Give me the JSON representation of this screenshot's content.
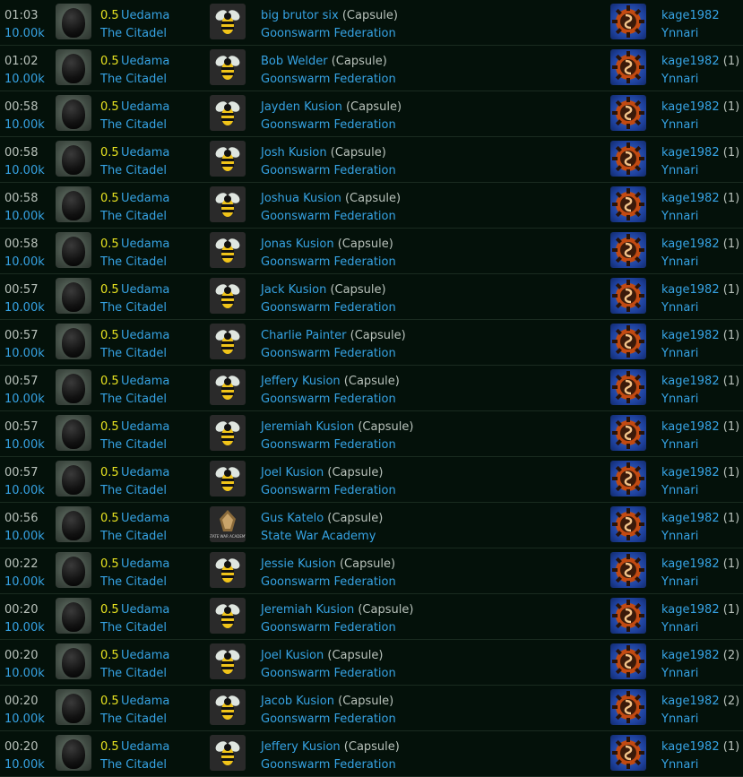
{
  "rows": [
    {
      "time": "01:03",
      "value": "10.00k",
      "sec": "0.5",
      "system": "Uedama",
      "region": "The Citadel",
      "victim": "big brutor six",
      "shiptype": "(Capsule)",
      "corp": "Goonswarm Federation",
      "corp_logo": "bee-icon",
      "attacker": "kage1982",
      "count": "",
      "att_corp": "Ynnari"
    },
    {
      "time": "01:02",
      "value": "10.00k",
      "sec": "0.5",
      "system": "Uedama",
      "region": "The Citadel",
      "victim": "Bob Welder",
      "shiptype": "(Capsule)",
      "corp": "Goonswarm Federation",
      "corp_logo": "bee-icon",
      "attacker": "kage1982",
      "count": "(1)",
      "att_corp": "Ynnari"
    },
    {
      "time": "00:58",
      "value": "10.00k",
      "sec": "0.5",
      "system": "Uedama",
      "region": "The Citadel",
      "victim": "Jayden Kusion",
      "shiptype": "(Capsule)",
      "corp": "Goonswarm Federation",
      "corp_logo": "bee-icon",
      "attacker": "kage1982",
      "count": "(1)",
      "att_corp": "Ynnari"
    },
    {
      "time": "00:58",
      "value": "10.00k",
      "sec": "0.5",
      "system": "Uedama",
      "region": "The Citadel",
      "victim": "Josh Kusion",
      "shiptype": "(Capsule)",
      "corp": "Goonswarm Federation",
      "corp_logo": "bee-icon",
      "attacker": "kage1982",
      "count": "(1)",
      "att_corp": "Ynnari"
    },
    {
      "time": "00:58",
      "value": "10.00k",
      "sec": "0.5",
      "system": "Uedama",
      "region": "The Citadel",
      "victim": "Joshua Kusion",
      "shiptype": "(Capsule)",
      "corp": "Goonswarm Federation",
      "corp_logo": "bee-icon",
      "attacker": "kage1982",
      "count": "(1)",
      "att_corp": "Ynnari"
    },
    {
      "time": "00:58",
      "value": "10.00k",
      "sec": "0.5",
      "system": "Uedama",
      "region": "The Citadel",
      "victim": "Jonas Kusion",
      "shiptype": "(Capsule)",
      "corp": "Goonswarm Federation",
      "corp_logo": "bee-icon",
      "attacker": "kage1982",
      "count": "(1)",
      "att_corp": "Ynnari"
    },
    {
      "time": "00:57",
      "value": "10.00k",
      "sec": "0.5",
      "system": "Uedama",
      "region": "The Citadel",
      "victim": "Jack Kusion",
      "shiptype": "(Capsule)",
      "corp": "Goonswarm Federation",
      "corp_logo": "bee-icon",
      "attacker": "kage1982",
      "count": "(1)",
      "att_corp": "Ynnari"
    },
    {
      "time": "00:57",
      "value": "10.00k",
      "sec": "0.5",
      "system": "Uedama",
      "region": "The Citadel",
      "victim": "Charlie Painter",
      "shiptype": "(Capsule)",
      "corp": "Goonswarm Federation",
      "corp_logo": "bee-icon",
      "attacker": "kage1982",
      "count": "(1)",
      "att_corp": "Ynnari"
    },
    {
      "time": "00:57",
      "value": "10.00k",
      "sec": "0.5",
      "system": "Uedama",
      "region": "The Citadel",
      "victim": "Jeffery Kusion",
      "shiptype": "(Capsule)",
      "corp": "Goonswarm Federation",
      "corp_logo": "bee-icon",
      "attacker": "kage1982",
      "count": "(1)",
      "att_corp": "Ynnari"
    },
    {
      "time": "00:57",
      "value": "10.00k",
      "sec": "0.5",
      "system": "Uedama",
      "region": "The Citadel",
      "victim": "Jeremiah Kusion",
      "shiptype": "(Capsule)",
      "corp": "Goonswarm Federation",
      "corp_logo": "bee-icon",
      "attacker": "kage1982",
      "count": "(1)",
      "att_corp": "Ynnari"
    },
    {
      "time": "00:57",
      "value": "10.00k",
      "sec": "0.5",
      "system": "Uedama",
      "region": "The Citadel",
      "victim": "Joel Kusion",
      "shiptype": "(Capsule)",
      "corp": "Goonswarm Federation",
      "corp_logo": "bee-icon",
      "attacker": "kage1982",
      "count": "(1)",
      "att_corp": "Ynnari"
    },
    {
      "time": "00:56",
      "value": "10.00k",
      "sec": "0.5",
      "system": "Uedama",
      "region": "The Citadel",
      "victim": "Gus Katelo",
      "shiptype": "(Capsule)",
      "corp": "State War Academy",
      "corp_logo": "state-war-academy-logo",
      "logo_text": "STATE WAR ACADEMY",
      "attacker": "kage1982",
      "count": "(1)",
      "att_corp": "Ynnari"
    },
    {
      "time": "00:22",
      "value": "10.00k",
      "sec": "0.5",
      "system": "Uedama",
      "region": "The Citadel",
      "victim": "Jessie Kusion",
      "shiptype": "(Capsule)",
      "corp": "Goonswarm Federation",
      "corp_logo": "bee-icon",
      "attacker": "kage1982",
      "count": "(1)",
      "att_corp": "Ynnari"
    },
    {
      "time": "00:20",
      "value": "10.00k",
      "sec": "0.5",
      "system": "Uedama",
      "region": "The Citadel",
      "victim": "Jeremiah Kusion",
      "shiptype": "(Capsule)",
      "corp": "Goonswarm Federation",
      "corp_logo": "bee-icon",
      "attacker": "kage1982",
      "count": "(1)",
      "att_corp": "Ynnari"
    },
    {
      "time": "00:20",
      "value": "10.00k",
      "sec": "0.5",
      "system": "Uedama",
      "region": "The Citadel",
      "victim": "Joel Kusion",
      "shiptype": "(Capsule)",
      "corp": "Goonswarm Federation",
      "corp_logo": "bee-icon",
      "attacker": "kage1982",
      "count": "(2)",
      "att_corp": "Ynnari"
    },
    {
      "time": "00:20",
      "value": "10.00k",
      "sec": "0.5",
      "system": "Uedama",
      "region": "The Citadel",
      "victim": "Jacob Kusion",
      "shiptype": "(Capsule)",
      "corp": "Goonswarm Federation",
      "corp_logo": "bee-icon",
      "attacker": "kage1982",
      "count": "(2)",
      "att_corp": "Ynnari"
    },
    {
      "time": "00:20",
      "value": "10.00k",
      "sec": "0.5",
      "system": "Uedama",
      "region": "The Citadel",
      "victim": "Jeffery Kusion",
      "shiptype": "(Capsule)",
      "corp": "Goonswarm Federation",
      "corp_logo": "bee-icon",
      "attacker": "kage1982",
      "count": "(1)",
      "att_corp": "Ynnari"
    }
  ],
  "ship_icon": "capsule-icon",
  "alliance_icon": "ynnari-gear-icon",
  "colors": {
    "link": "#36a3e4",
    "security": "#e8e321",
    "muted": "#b9c2bb",
    "background": "#04110a"
  }
}
